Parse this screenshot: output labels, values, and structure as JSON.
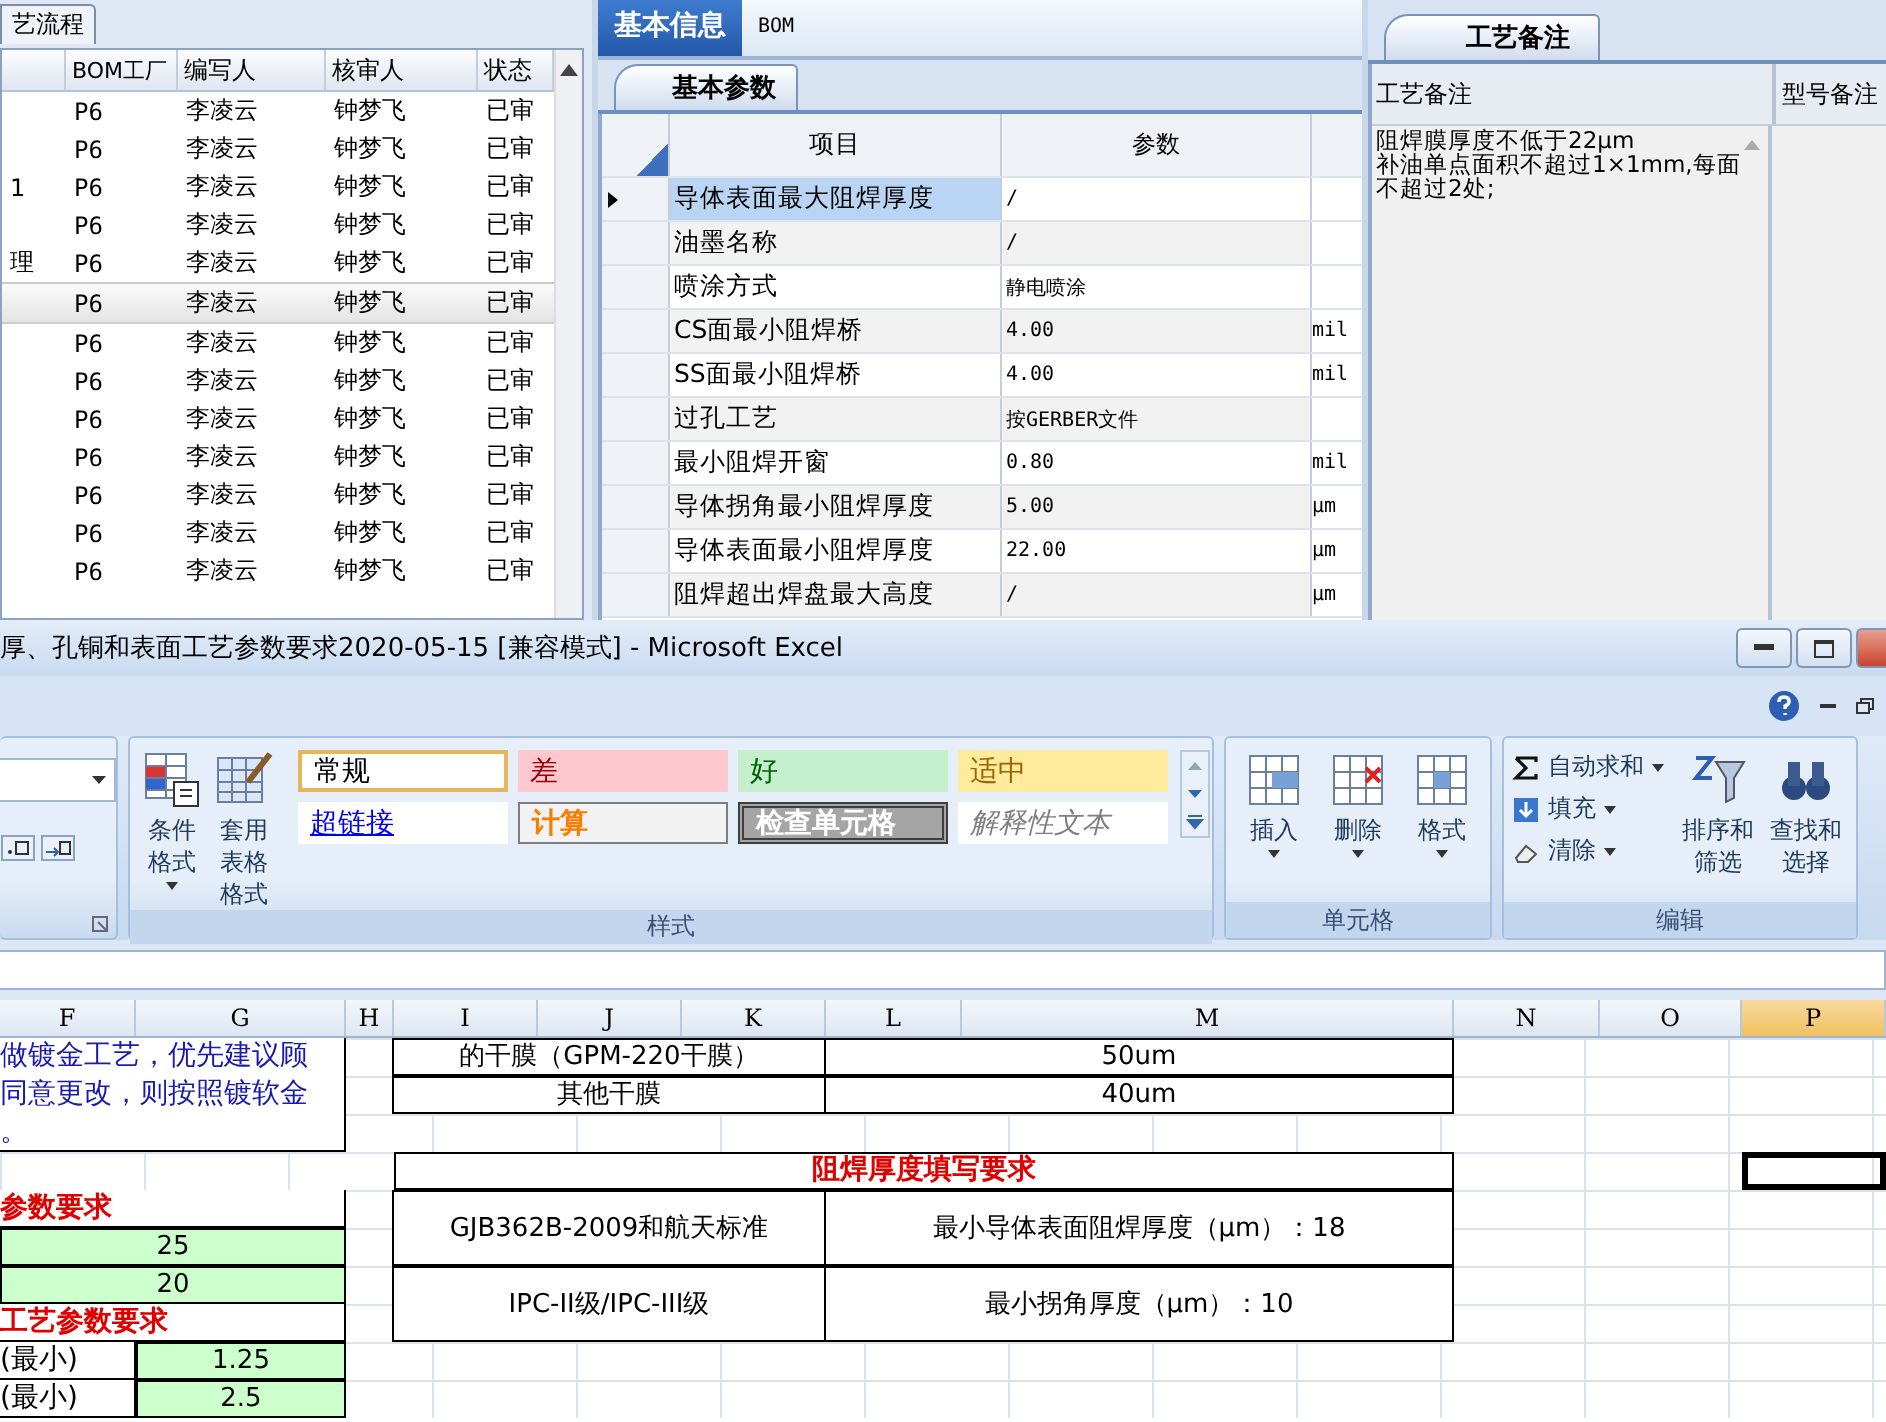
{
  "process_panel": {
    "tab": "艺流程",
    "columns": [
      "",
      "BOM工厂",
      "编写人",
      "核审人",
      "状态"
    ],
    "rows": [
      {
        "c1": "",
        "factory": "P6",
        "writer": "李凌云",
        "reviewer": "钟梦飞",
        "status": "已审",
        "selected": false
      },
      {
        "c1": "",
        "factory": "P6",
        "writer": "李凌云",
        "reviewer": "钟梦飞",
        "status": "已审",
        "selected": false
      },
      {
        "c1": "1",
        "factory": "P6",
        "writer": "李凌云",
        "reviewer": "钟梦飞",
        "status": "已审",
        "selected": false
      },
      {
        "c1": "",
        "factory": "P6",
        "writer": "李凌云",
        "reviewer": "钟梦飞",
        "status": "已审",
        "selected": false
      },
      {
        "c1": "理",
        "factory": "P6",
        "writer": "李凌云",
        "reviewer": "钟梦飞",
        "status": "已审",
        "selected": false
      },
      {
        "c1": "",
        "factory": "P6",
        "writer": "李凌云",
        "reviewer": "钟梦飞",
        "status": "已审",
        "selected": true
      },
      {
        "c1": "",
        "factory": "P6",
        "writer": "李凌云",
        "reviewer": "钟梦飞",
        "status": "已审",
        "selected": false
      },
      {
        "c1": "",
        "factory": "P6",
        "writer": "李凌云",
        "reviewer": "钟梦飞",
        "status": "已审",
        "selected": false
      },
      {
        "c1": "",
        "factory": "P6",
        "writer": "李凌云",
        "reviewer": "钟梦飞",
        "status": "已审",
        "selected": false
      },
      {
        "c1": "",
        "factory": "P6",
        "writer": "李凌云",
        "reviewer": "钟梦飞",
        "status": "已审",
        "selected": false
      },
      {
        "c1": "",
        "factory": "P6",
        "writer": "李凌云",
        "reviewer": "钟梦飞",
        "status": "已审",
        "selected": false
      },
      {
        "c1": "",
        "factory": "P6",
        "writer": "李凌云",
        "reviewer": "钟梦飞",
        "status": "已审",
        "selected": false
      },
      {
        "c1": "",
        "factory": "P6",
        "writer": "李凌云",
        "reviewer": "钟梦飞",
        "status": "已审",
        "selected": false
      }
    ]
  },
  "info_panel": {
    "tabs": [
      {
        "label": "基本信息",
        "selected": true
      },
      {
        "label": "BOM",
        "selected": false
      }
    ],
    "subtab": "基本参数",
    "columns": [
      "项目",
      "参数"
    ],
    "rows": [
      {
        "item": "导体表面最大阻焊厚度",
        "value": "/",
        "unit": "",
        "selected": true
      },
      {
        "item": "油墨名称",
        "value": "/",
        "unit": "",
        "selected": false
      },
      {
        "item": "喷涂方式",
        "value": "静电喷涂",
        "unit": "",
        "selected": false
      },
      {
        "item": "CS面最小阻焊桥",
        "value": "4.00",
        "unit": "mil",
        "selected": false
      },
      {
        "item": "SS面最小阻焊桥",
        "value": "4.00",
        "unit": "mil",
        "selected": false
      },
      {
        "item": "过孔工艺",
        "value": "按GERBER文件",
        "unit": "",
        "selected": false
      },
      {
        "item": "最小阻焊开窗",
        "value": "0.80",
        "unit": "mil",
        "selected": false
      },
      {
        "item": "导体拐角最小阻焊厚度",
        "value": "5.00",
        "unit": "μm",
        "selected": false
      },
      {
        "item": "导体表面最小阻焊厚度",
        "value": "22.00",
        "unit": "μm",
        "selected": false
      },
      {
        "item": "阻焊超出焊盘最大高度",
        "value": "/",
        "unit": "μm",
        "selected": false
      }
    ]
  },
  "notes_panel": {
    "tab": "工艺备注",
    "columns": [
      "工艺备注",
      "型号备注"
    ],
    "note_lines": [
      "阻焊膜厚度不低于22μm",
      "补油单点面积不超过1×1mm,每面",
      "不超过2处;"
    ]
  },
  "excel": {
    "title": "厚、孔铜和表面工艺参数要求2020-05-15  [兼容模式] - Microsoft Excel",
    "groups": [
      {
        "label": "样式",
        "buttons": [
          "条件格式",
          "套用表格格式"
        ],
        "styles": [
          {
            "label": "常规",
            "kind": "normal"
          },
          {
            "label": "差",
            "kind": "bad"
          },
          {
            "label": "好",
            "kind": "good"
          },
          {
            "label": "适中",
            "kind": "neutral"
          },
          {
            "label": "超链接",
            "kind": "link"
          },
          {
            "label": "计算",
            "kind": "calc"
          },
          {
            "label": "检查单元格",
            "kind": "check"
          },
          {
            "label": "解释性文本",
            "kind": "explain"
          }
        ]
      },
      {
        "label": "单元格",
        "buttons": [
          "插入",
          "删除",
          "格式"
        ]
      },
      {
        "label": "编辑",
        "small": [
          "自动求和",
          "填充",
          "清除"
        ],
        "buttons": [
          "排序和筛选",
          "查找和选择"
        ]
      }
    ],
    "columns": [
      {
        "label": "F",
        "selected": false
      },
      {
        "label": "G",
        "selected": false
      },
      {
        "label": "H",
        "selected": false
      },
      {
        "label": "I",
        "selected": false
      },
      {
        "label": "J",
        "selected": false
      },
      {
        "label": "K",
        "selected": false
      },
      {
        "label": "L",
        "selected": false
      },
      {
        "label": "M",
        "selected": false
      },
      {
        "label": "N",
        "selected": false
      },
      {
        "label": "O",
        "selected": false
      },
      {
        "label": "P",
        "selected": true
      }
    ],
    "cells": [
      {
        "kind": "note",
        "lines": [
          "做镀金工艺，优先建议顾",
          "同意更改，则按照镀软金",
          "。"
        ],
        "selected": false
      },
      {
        "kind": "text",
        "lines": [
          "的干膜（GPM-220干膜）"
        ],
        "selected": false
      },
      {
        "kind": "text",
        "lines": [
          "50um"
        ],
        "selected": false
      },
      {
        "kind": "text",
        "lines": [
          "其他干膜"
        ],
        "selected": false
      },
      {
        "kind": "text",
        "lines": [
          "40um"
        ],
        "selected": false
      },
      {
        "kind": "heading",
        "lines": [
          "阻焊厚度填写要求"
        ],
        "selected": false
      },
      {
        "kind": "empty",
        "selected": true
      },
      {
        "kind": "heading-left",
        "lines": [
          "参数要求"
        ],
        "selected": false
      },
      {
        "kind": "text",
        "lines": [
          "GJB362B-2009和航天标准"
        ],
        "selected": false
      },
      {
        "kind": "text",
        "lines": [
          "最小导体表面阻焊厚度（μm）：18"
        ],
        "selected": false
      },
      {
        "kind": "value",
        "lines": [
          "25"
        ],
        "selected": false
      },
      {
        "kind": "value",
        "lines": [
          "20"
        ],
        "selected": false
      },
      {
        "kind": "text",
        "lines": [
          "IPC-II级/IPC-III级"
        ],
        "selected": false
      },
      {
        "kind": "text",
        "lines": [
          "最小拐角厚度（μm）：10"
        ],
        "selected": false
      },
      {
        "kind": "heading-left",
        "lines": [
          "工艺参数要求"
        ],
        "selected": false
      },
      {
        "kind": "label",
        "lines": [
          "(最小)"
        ],
        "selected": false
      },
      {
        "kind": "value",
        "lines": [
          "1.25"
        ],
        "selected": false
      },
      {
        "kind": "label",
        "lines": [
          "(最小)"
        ],
        "selected": false
      },
      {
        "kind": "value",
        "lines": [
          "2.5"
        ],
        "selected": false
      }
    ]
  }
}
